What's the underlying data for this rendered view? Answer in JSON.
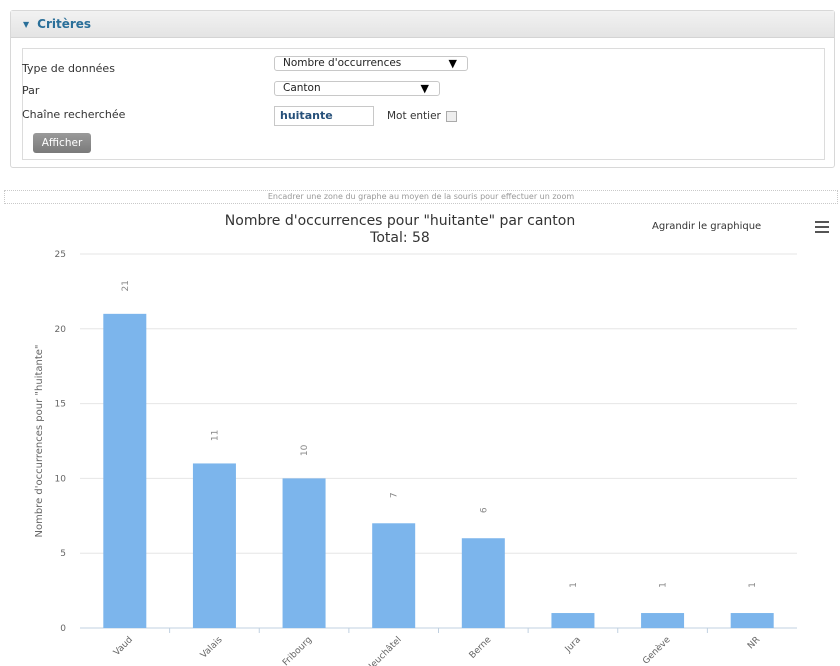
{
  "criteria": {
    "title": "Critères",
    "rows": [
      {
        "label": "Type de données",
        "value": "Nombre d'occurrences"
      },
      {
        "label": "Par",
        "value": "Canton"
      },
      {
        "label": "Chaîne recherchée",
        "value": "huitante"
      }
    ],
    "whole_word_label": "Mot entier",
    "whole_word_checked": false,
    "submit_label": "Afficher"
  },
  "zoom_hint": "Encadrer une zone du graphe au moyen de la souris pour effectuer un zoom",
  "chart_toolbar": {
    "enlarge_label": "Agrandir le graphique",
    "menu_icon": "hamburger-menu-icon"
  },
  "chart_data": {
    "type": "bar",
    "title": "Nombre d'occurrences pour \"huitante\" par canton",
    "subtitle": "Total: 58",
    "xlabel": "",
    "ylabel": "Nombre d'occurrences pour \"huitante\"",
    "categories": [
      "Vaud",
      "Valais",
      "Fribourg",
      "Neuchâtel",
      "Berne",
      "Jura",
      "Genève",
      "NR"
    ],
    "values": [
      21,
      11,
      10,
      7,
      6,
      1,
      1,
      1
    ],
    "ylim": [
      0,
      25
    ],
    "yticks": [
      0,
      5,
      10,
      15,
      20,
      25
    ],
    "bar_color": "#7cb5ec",
    "grid": true,
    "data_labels": true
  }
}
